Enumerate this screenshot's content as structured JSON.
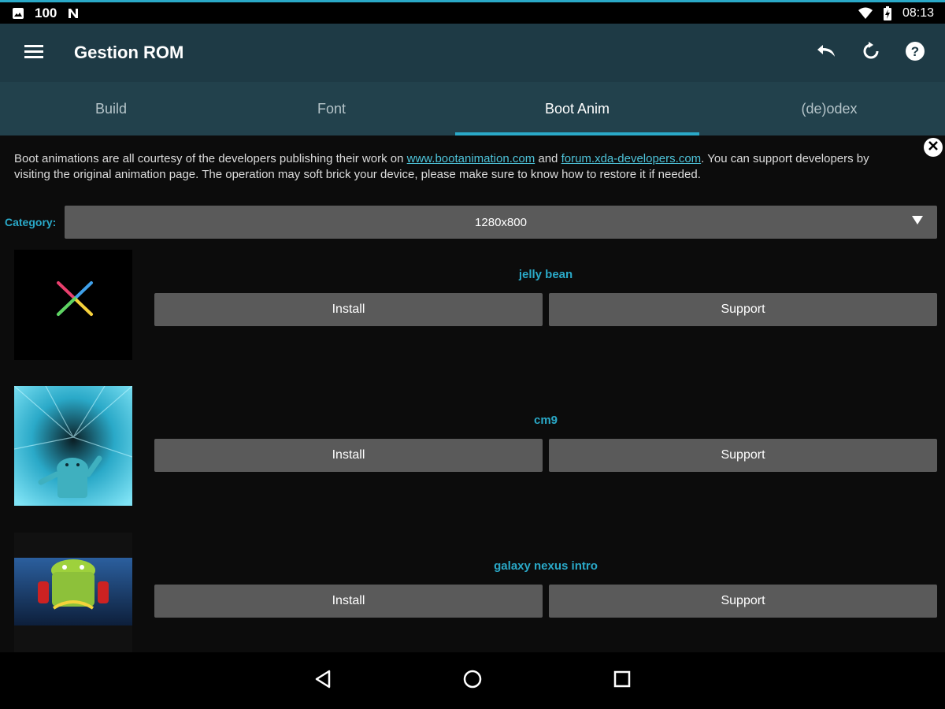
{
  "status_bar": {
    "time": "08:13",
    "notif_text": "100",
    "icons": [
      "image-icon",
      "100-badge-icon",
      "n-icon",
      "wifi-icon",
      "battery-icon"
    ]
  },
  "toolbar": {
    "title": "Gestion ROM",
    "icons": [
      "menu-icon",
      "undo-icon",
      "refresh-icon",
      "help-icon"
    ]
  },
  "tabs": [
    {
      "label": "Build",
      "active": false
    },
    {
      "label": "Font",
      "active": false
    },
    {
      "label": "Boot Anim",
      "active": true
    },
    {
      "label": "(de)odex",
      "active": false
    }
  ],
  "notice": {
    "part1": "Boot animations are all courtesy of the developers publishing their work on ",
    "link1": "www.bootanimation.com",
    "part2": " and ",
    "link2": "forum.xda-developers.com",
    "part3": ". You can support developers by visiting the original animation page. The operation may soft brick your device, please make sure to know how to restore it if needed."
  },
  "category": {
    "label": "Category:",
    "selected": "1280x800"
  },
  "animations": [
    {
      "name": "jelly bean",
      "install_label": "Install",
      "support_label": "Support"
    },
    {
      "name": "cm9",
      "install_label": "Install",
      "support_label": "Support"
    },
    {
      "name": "galaxy nexus intro",
      "install_label": "Install",
      "support_label": "Support"
    }
  ],
  "nav_bar": {
    "icons": [
      "back-icon",
      "home-icon",
      "recents-icon"
    ]
  },
  "colors": {
    "accent": "#2aa9c8",
    "toolbar": "#1e3a45",
    "tabs": "#22414c",
    "button": "#5a5a5a"
  }
}
